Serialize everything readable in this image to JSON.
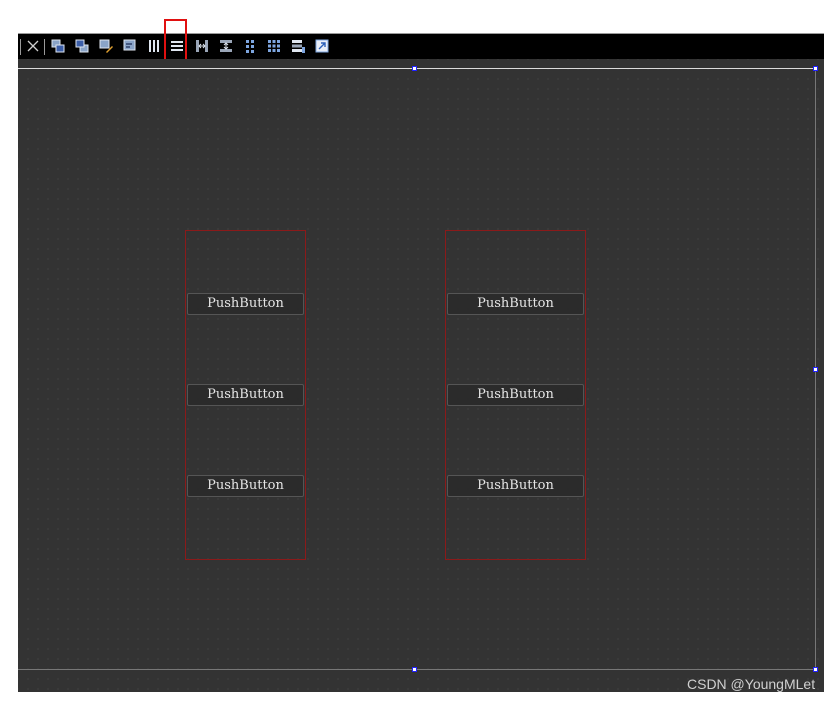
{
  "toolbar": {
    "icons": [
      "close-icon",
      "bring-to-front-icon",
      "send-to-back-icon",
      "edit-widgets-icon",
      "edit-buddies-icon",
      "layout-horizontally-icon",
      "layout-vertically-icon",
      "splitter-horizontal-icon",
      "splitter-vertical-icon",
      "layout-form-icon",
      "layout-grid-icon",
      "break-layout-icon",
      "adjust-size-icon"
    ],
    "highlight_color": "#e01010"
  },
  "form": {
    "background": "#333333",
    "layouts": [
      {
        "name": "vertical-layout-left",
        "buttons": [
          "PushButton",
          "PushButton",
          "PushButton"
        ]
      },
      {
        "name": "vertical-layout-right",
        "buttons": [
          "PushButton",
          "PushButton",
          "PushButton"
        ]
      }
    ]
  },
  "watermark": "CSDN @YoungMLet"
}
